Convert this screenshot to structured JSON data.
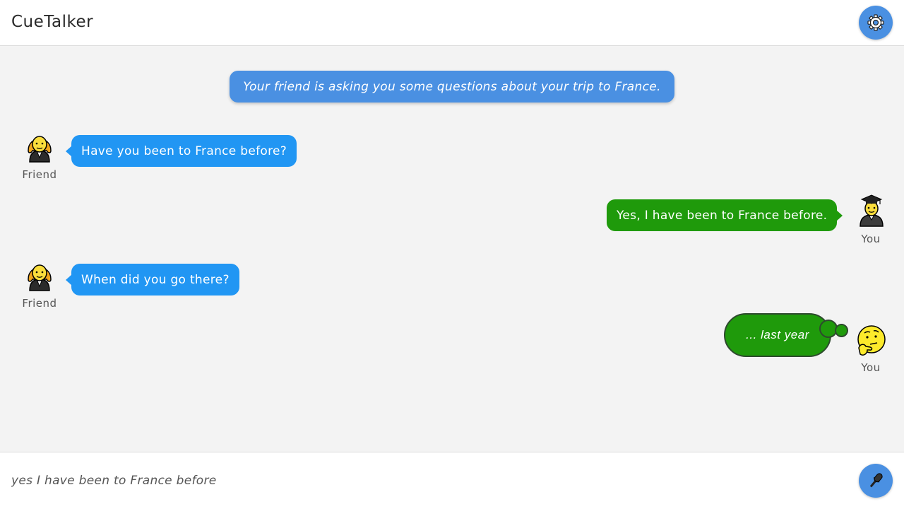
{
  "app": {
    "title": "CueTalker"
  },
  "header": {
    "settings_icon": "gear-icon"
  },
  "chat": {
    "context": "Your friend is asking you some questions about your trip to France.",
    "messages": [
      {
        "speaker": "Friend",
        "text": "Have you been to France before?",
        "avatar": "woman-teacher-emoji"
      },
      {
        "speaker": "You",
        "text": "Yes, I have been to France before.",
        "avatar": "student-emoji"
      },
      {
        "speaker": "Friend",
        "text": "When did you go there?",
        "avatar": "woman-teacher-emoji"
      }
    ],
    "cue": {
      "speaker": "You",
      "text": "... last year",
      "avatar": "thinking-face-emoji"
    }
  },
  "footer": {
    "transcript": "yes I have been to France before",
    "mic_icon": "microphone-icon"
  },
  "colors": {
    "accent": "#4a90e2",
    "friend_bubble": "#2196f3",
    "you_bubble": "#1f9a0b",
    "background": "#f3f3f3"
  }
}
